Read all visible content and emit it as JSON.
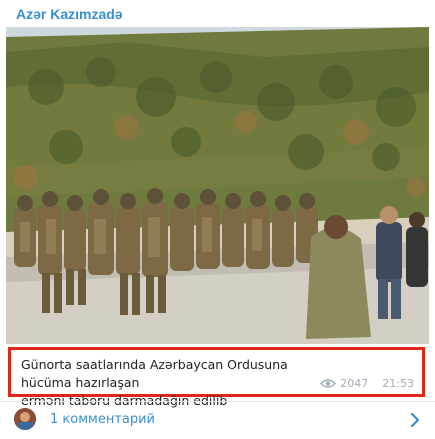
{
  "post": {
    "sender_name": "Azər Kazımzadə",
    "caption_line1": "Günorta saatlarında Azərbaycan Ordusuna hücüma hazırlaşan",
    "caption_line2": "erməni taboru darmadağın edilib",
    "views": "2047",
    "time": "21:53"
  },
  "comments": {
    "label": "1 комментарий"
  },
  "icons": {
    "views": "eye-icon",
    "comments_avatar": "commenter-avatar",
    "open_comments": "chevron-right-icon"
  },
  "colors": {
    "accent": "#3a8fd1",
    "highlight_border": "#e0251b",
    "meta_text": "#a3adb6"
  }
}
